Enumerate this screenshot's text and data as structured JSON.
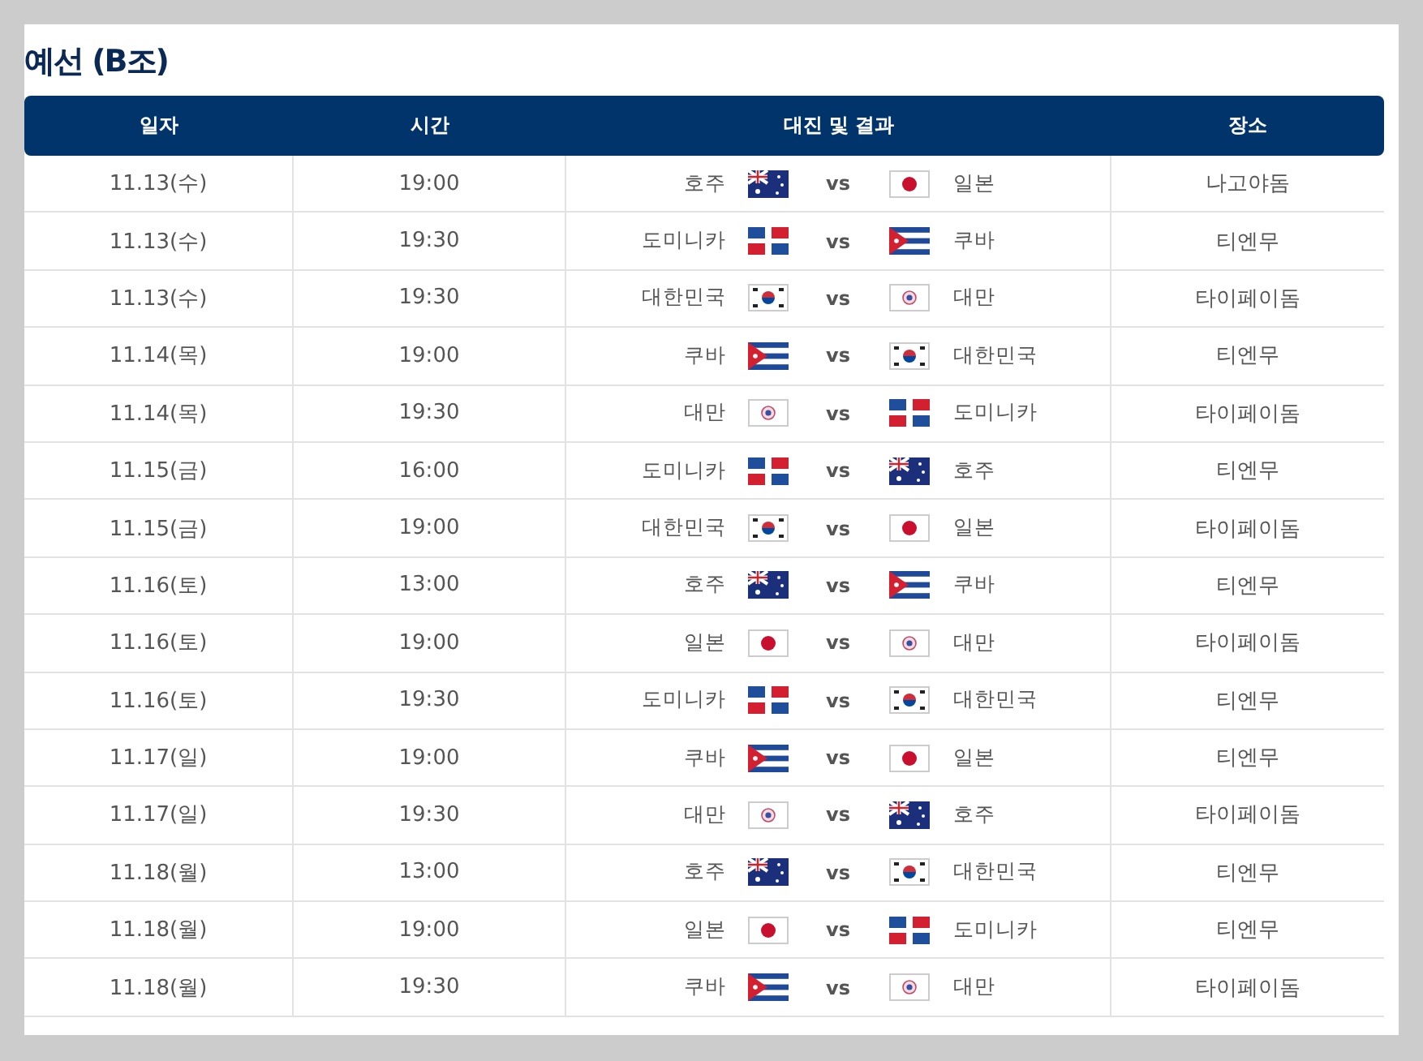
{
  "title": "예선 (B조)",
  "columns": [
    "일자",
    "시간",
    "대진 및 결과",
    "장소"
  ],
  "rows": [
    {
      "date": "11.13(수)",
      "time": "19:00",
      "home": {
        "name": "호주",
        "kind": "aus"
      },
      "vs": "vs",
      "away": {
        "name": "일본",
        "kind": "jpn"
      },
      "venue": "나고야돔"
    },
    {
      "date": "11.13(수)",
      "time": "19:30",
      "home": {
        "name": "도미니카",
        "kind": "dom"
      },
      "vs": "vs",
      "away": {
        "name": "쿠바",
        "kind": "cub"
      },
      "venue": "티엔무"
    },
    {
      "date": "11.13(수)",
      "time": "19:30",
      "home": {
        "name": "대한민국",
        "kind": "kor"
      },
      "vs": "vs",
      "away": {
        "name": "대만",
        "kind": "tpe"
      },
      "venue": "타이페이돔"
    },
    {
      "date": "11.14(목)",
      "time": "19:00",
      "home": {
        "name": "쿠바",
        "kind": "cub"
      },
      "vs": "vs",
      "away": {
        "name": "대한민국",
        "kind": "kor"
      },
      "venue": "티엔무"
    },
    {
      "date": "11.14(목)",
      "time": "19:30",
      "home": {
        "name": "대만",
        "kind": "tpe"
      },
      "vs": "vs",
      "away": {
        "name": "도미니카",
        "kind": "dom"
      },
      "venue": "타이페이돔"
    },
    {
      "date": "11.15(금)",
      "time": "16:00",
      "home": {
        "name": "도미니카",
        "kind": "dom"
      },
      "vs": "vs",
      "away": {
        "name": "호주",
        "kind": "aus"
      },
      "venue": "티엔무"
    },
    {
      "date": "11.15(금)",
      "time": "19:00",
      "home": {
        "name": "대한민국",
        "kind": "kor"
      },
      "vs": "vs",
      "away": {
        "name": "일본",
        "kind": "jpn"
      },
      "venue": "타이페이돔"
    },
    {
      "date": "11.16(토)",
      "time": "13:00",
      "home": {
        "name": "호주",
        "kind": "aus"
      },
      "vs": "vs",
      "away": {
        "name": "쿠바",
        "kind": "cub"
      },
      "venue": "티엔무"
    },
    {
      "date": "11.16(토)",
      "time": "19:00",
      "home": {
        "name": "일본",
        "kind": "jpn"
      },
      "vs": "vs",
      "away": {
        "name": "대만",
        "kind": "tpe"
      },
      "venue": "타이페이돔"
    },
    {
      "date": "11.16(토)",
      "time": "19:30",
      "home": {
        "name": "도미니카",
        "kind": "dom"
      },
      "vs": "vs",
      "away": {
        "name": "대한민국",
        "kind": "kor"
      },
      "venue": "티엔무"
    },
    {
      "date": "11.17(일)",
      "time": "19:00",
      "home": {
        "name": "쿠바",
        "kind": "cub"
      },
      "vs": "vs",
      "away": {
        "name": "일본",
        "kind": "jpn"
      },
      "venue": "티엔무"
    },
    {
      "date": "11.17(일)",
      "time": "19:30",
      "home": {
        "name": "대만",
        "kind": "tpe"
      },
      "vs": "vs",
      "away": {
        "name": "호주",
        "kind": "aus"
      },
      "venue": "타이페이돔"
    },
    {
      "date": "11.18(월)",
      "time": "13:00",
      "home": {
        "name": "호주",
        "kind": "aus"
      },
      "vs": "vs",
      "away": {
        "name": "대한민국",
        "kind": "kor"
      },
      "venue": "티엔무"
    },
    {
      "date": "11.18(월)",
      "time": "19:00",
      "home": {
        "name": "일본",
        "kind": "jpn"
      },
      "vs": "vs",
      "away": {
        "name": "도미니카",
        "kind": "dom"
      },
      "venue": "티엔무"
    },
    {
      "date": "11.18(월)",
      "time": "19:30",
      "home": {
        "name": "쿠바",
        "kind": "cub"
      },
      "vs": "vs",
      "away": {
        "name": "대만",
        "kind": "tpe"
      },
      "venue": "타이페이돔"
    }
  ]
}
